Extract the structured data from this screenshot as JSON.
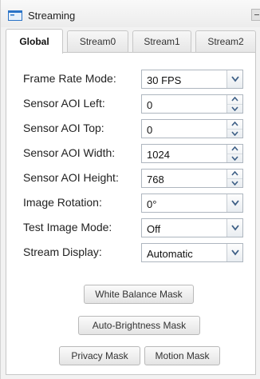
{
  "panel": {
    "title": "Streaming",
    "title_icon": "streaming-panel-icon",
    "collapse_icon": "collapse-icon"
  },
  "tabs": [
    {
      "label": "Global",
      "active": true
    },
    {
      "label": "Stream0",
      "active": false
    },
    {
      "label": "Stream1",
      "active": false
    },
    {
      "label": "Stream2",
      "active": false
    }
  ],
  "fields": [
    {
      "label": "Frame Rate Mode:",
      "value": "30 FPS",
      "control": "dropdown"
    },
    {
      "label": "Sensor AOI Left:",
      "value": "0",
      "control": "spinner"
    },
    {
      "label": "Sensor AOI Top:",
      "value": "0",
      "control": "spinner"
    },
    {
      "label": "Sensor AOI Width:",
      "value": "1024",
      "control": "spinner"
    },
    {
      "label": "Sensor AOI Height:",
      "value": "768",
      "control": "spinner"
    },
    {
      "label": "Image Rotation:",
      "value": "0°",
      "control": "dropdown"
    },
    {
      "label": "Test Image Mode:",
      "value": "Off",
      "control": "dropdown"
    },
    {
      "label": "Stream Display:",
      "value": "Automatic",
      "control": "dropdown"
    }
  ],
  "buttons": {
    "white_balance_mask": "White Balance Mask",
    "auto_brightness_mask": "Auto-Brightness Mask",
    "privacy_mask": "Privacy Mask",
    "motion_mask": "Motion Mask"
  },
  "colors": {
    "arrow": "#3d5f86",
    "title_icon": "#2a73c7"
  }
}
